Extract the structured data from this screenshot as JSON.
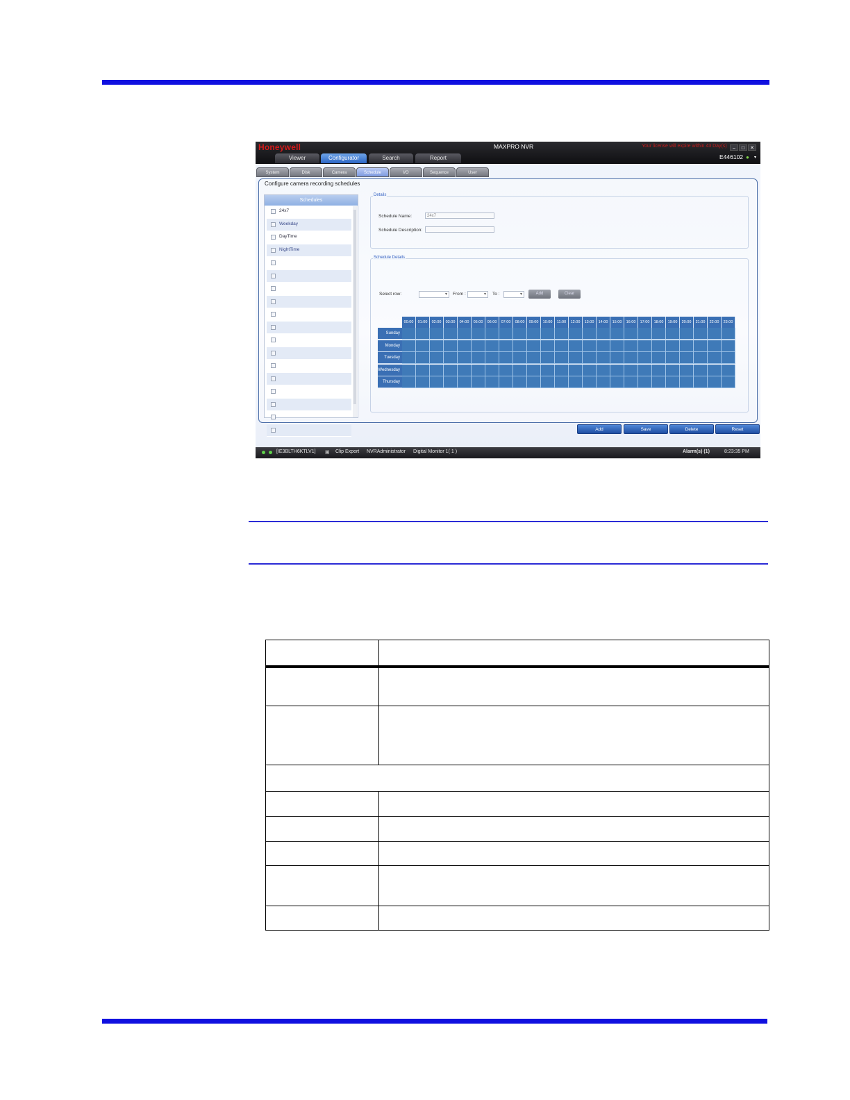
{
  "app": {
    "logo": "Honeywell",
    "title": "MAXPRO NVR",
    "license_notice": "Your license will expire within 43 Day(s)",
    "user_id": "E446102",
    "main_tabs": [
      "Viewer",
      "Configurator",
      "Search",
      "Report"
    ],
    "active_main_tab": "Configurator",
    "sub_tabs": [
      "System",
      "Disk",
      "Camera",
      "Schedule",
      "I/O",
      "Sequence",
      "User"
    ],
    "active_sub_tab": "Schedule",
    "panel_title": "Configure camera recording schedules",
    "schedules_header": "Schedules",
    "schedules": [
      "24x7",
      "Weekday",
      "DayTime",
      "NightTime",
      "",
      "",
      "",
      "",
      "",
      "",
      "",
      "",
      "",
      "",
      "",
      "",
      "",
      ""
    ],
    "details": {
      "legend": "Details",
      "name_label": "Schedule Name:",
      "name_value": "24x7",
      "desc_label": "Schedule Description:",
      "desc_value": ""
    },
    "schedule_details": {
      "legend": "Schedule Details",
      "select_row_label": "Select row:",
      "from_label": "From :",
      "to_label": "To :",
      "add_label": "Add",
      "clear_label": "Clear",
      "hours": [
        "00:00",
        "01:00",
        "02:00",
        "03:00",
        "04:00",
        "05:00",
        "06:00",
        "07:00",
        "08:00",
        "09:00",
        "10:00",
        "11:00",
        "12:00",
        "13:00",
        "14:00",
        "15:00",
        "16:00",
        "17:00",
        "18:00",
        "19:00",
        "20:00",
        "21:00",
        "22:00",
        "23:00"
      ],
      "days": [
        "Sunday",
        "Monday",
        "Tuesday",
        "Wednesday",
        "Thursday"
      ]
    },
    "actions": [
      "Add",
      "Save",
      "Delete",
      "Reset"
    ],
    "status": {
      "host": "[IE3BLTH6KTLV1]",
      "clip_export": "Clip Export",
      "user": "NVRAdministrator",
      "monitor": "Digital Monitor 1( 1 )",
      "alarms": "Alarm(s) (1)",
      "time": "8:23:35 PM"
    },
    "colors": {
      "grid_blue": "#3f7ab8",
      "title_red": "#d41a1a",
      "accent": "#2d66c4"
    }
  },
  "doc_table": {
    "row_heights": []
  }
}
